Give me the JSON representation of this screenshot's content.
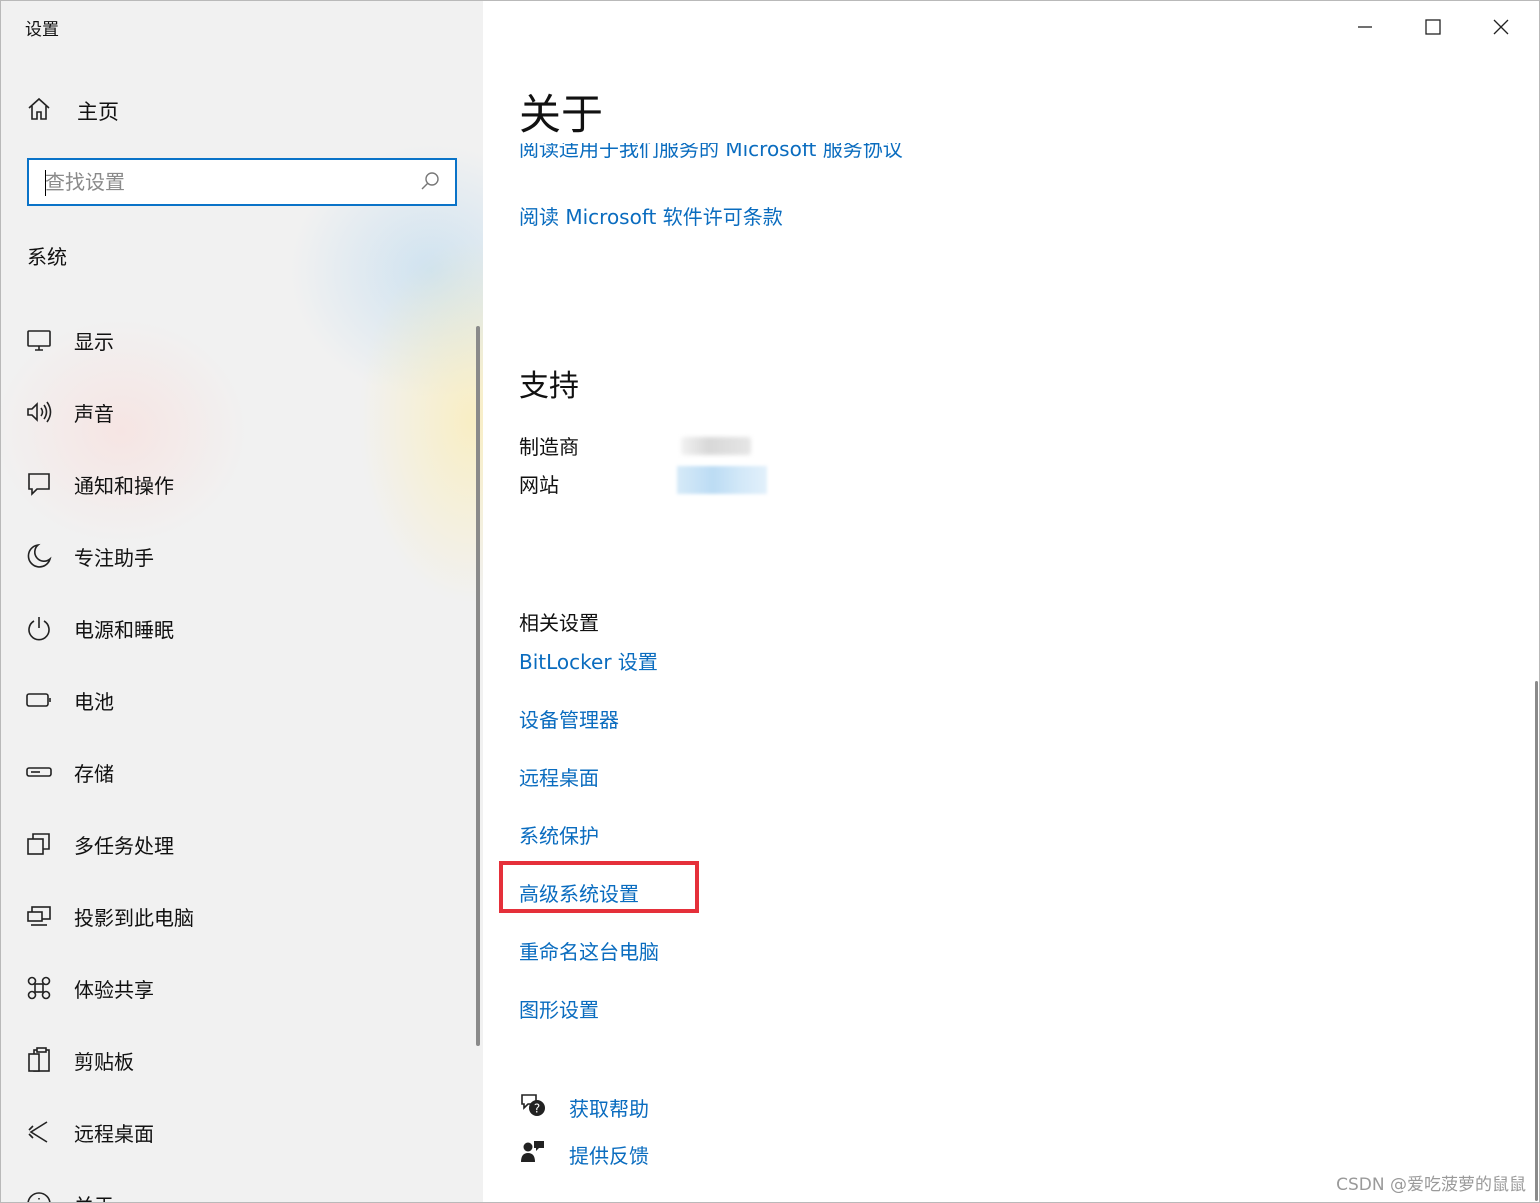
{
  "window": {
    "title": "设置"
  },
  "sidebar": {
    "home_label": "主页",
    "search_placeholder": "查找设置",
    "section_label": "系统",
    "items": [
      {
        "label": "显示",
        "icon": "monitor-icon"
      },
      {
        "label": "声音",
        "icon": "speaker-icon"
      },
      {
        "label": "通知和操作",
        "icon": "notification-icon"
      },
      {
        "label": "专注助手",
        "icon": "moon-icon"
      },
      {
        "label": "电源和睡眠",
        "icon": "power-icon"
      },
      {
        "label": "电池",
        "icon": "battery-icon"
      },
      {
        "label": "存储",
        "icon": "storage-icon"
      },
      {
        "label": "多任务处理",
        "icon": "multitask-icon"
      },
      {
        "label": "投影到此电脑",
        "icon": "project-icon"
      },
      {
        "label": "体验共享",
        "icon": "share-icon"
      },
      {
        "label": "剪贴板",
        "icon": "clipboard-icon"
      },
      {
        "label": "远程桌面",
        "icon": "remote-desktop-icon"
      },
      {
        "label": "关于",
        "icon": "info-icon"
      }
    ]
  },
  "content": {
    "page_title": "关于",
    "links_top": [
      "阅读适用于我们服务的 Microsoft 服务协议",
      "阅读 Microsoft 软件许可条款"
    ],
    "support": {
      "heading": "支持",
      "manufacturer_label": "制造商",
      "website_label": "网站"
    },
    "related": {
      "heading": "相关设置",
      "links": [
        "BitLocker 设置",
        "设备管理器",
        "远程桌面",
        "系统保护",
        "高级系统设置",
        "重命名这台电脑",
        "图形设置"
      ],
      "highlighted_index": 4,
      "highlight_color": "#e5303a"
    },
    "help": {
      "get_help": "获取帮助",
      "feedback": "提供反馈"
    }
  },
  "watermark": "CSDN @爱吃菠萝的鼠鼠",
  "colors": {
    "accent": "#0a6cbf",
    "search_border": "#0a73c8",
    "highlight": "#e5303a"
  }
}
